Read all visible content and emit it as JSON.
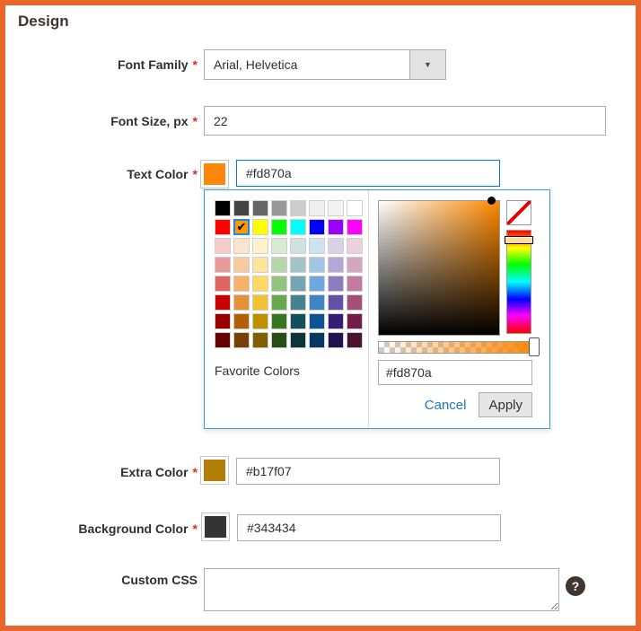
{
  "page": {
    "title": "Design"
  },
  "ui": {
    "required_marker": "*",
    "icons": {
      "dropdown": "▼",
      "check": "✔",
      "help": "?"
    },
    "colors": {
      "frame_border": "#e8672c",
      "focus_border": "#007bdb",
      "picker_border": "#3c97e0",
      "link_blue": "#1f78c1",
      "required_red": "#e02b27"
    }
  },
  "form": {
    "font_family": {
      "label": "Font Family",
      "required": true,
      "value": "Arial, Helvetica"
    },
    "font_size": {
      "label": "Font Size, px",
      "required": true,
      "value": "22"
    },
    "text_color": {
      "label": "Text Color",
      "required": true,
      "value": "#fd870a",
      "swatch": "#fd870a"
    },
    "extra_color": {
      "label": "Extra Color",
      "required": true,
      "value": "#b17f07",
      "swatch": "#b17f07"
    },
    "background_color": {
      "label": "Background Color",
      "required": true,
      "value": "#343434",
      "swatch": "#343434"
    },
    "custom_css": {
      "label": "Custom CSS",
      "required": false,
      "value": ""
    }
  },
  "color_picker": {
    "palette": [
      [
        "#000000",
        "#444444",
        "#666666",
        "#999999",
        "#cccccc",
        "#eeeeee",
        "#f3f3f3",
        "#ffffff"
      ],
      [
        "#ff0000",
        "#ff9900",
        "#ffff00",
        "#00ff00",
        "#00ffff",
        "#0000ff",
        "#9900ff",
        "#ff00ff"
      ],
      [
        "#f4cccc",
        "#fce5cd",
        "#fff2cc",
        "#d9ead3",
        "#d0e0e3",
        "#cfe2f3",
        "#d9d2e9",
        "#ead1dc"
      ],
      [
        "#ea9999",
        "#f9cb9c",
        "#ffe599",
        "#b6d7a8",
        "#a2c4c9",
        "#9fc5e8",
        "#b4a7d6",
        "#d5a6bd"
      ],
      [
        "#e06666",
        "#f6b26b",
        "#ffd966",
        "#93c47d",
        "#76a5af",
        "#6fa8dc",
        "#8e7cc3",
        "#c27ba0"
      ],
      [
        "#cc0000",
        "#e69138",
        "#f1c232",
        "#6aa84f",
        "#45818e",
        "#3d85c6",
        "#674ea7",
        "#a64d79"
      ],
      [
        "#990000",
        "#b45f06",
        "#bf9000",
        "#38761d",
        "#134f5c",
        "#0b5394",
        "#351c75",
        "#741b47"
      ],
      [
        "#660000",
        "#783f04",
        "#7f6000",
        "#274e13",
        "#0c343d",
        "#073763",
        "#20124d",
        "#4c1130"
      ]
    ],
    "selected": {
      "row": 1,
      "col": 1,
      "hex": "#ff9900"
    },
    "favorites_label": "Favorite Colors",
    "hue_base": "#ff8800",
    "hex_value": "#fd870a",
    "cancel_label": "Cancel",
    "apply_label": "Apply"
  }
}
